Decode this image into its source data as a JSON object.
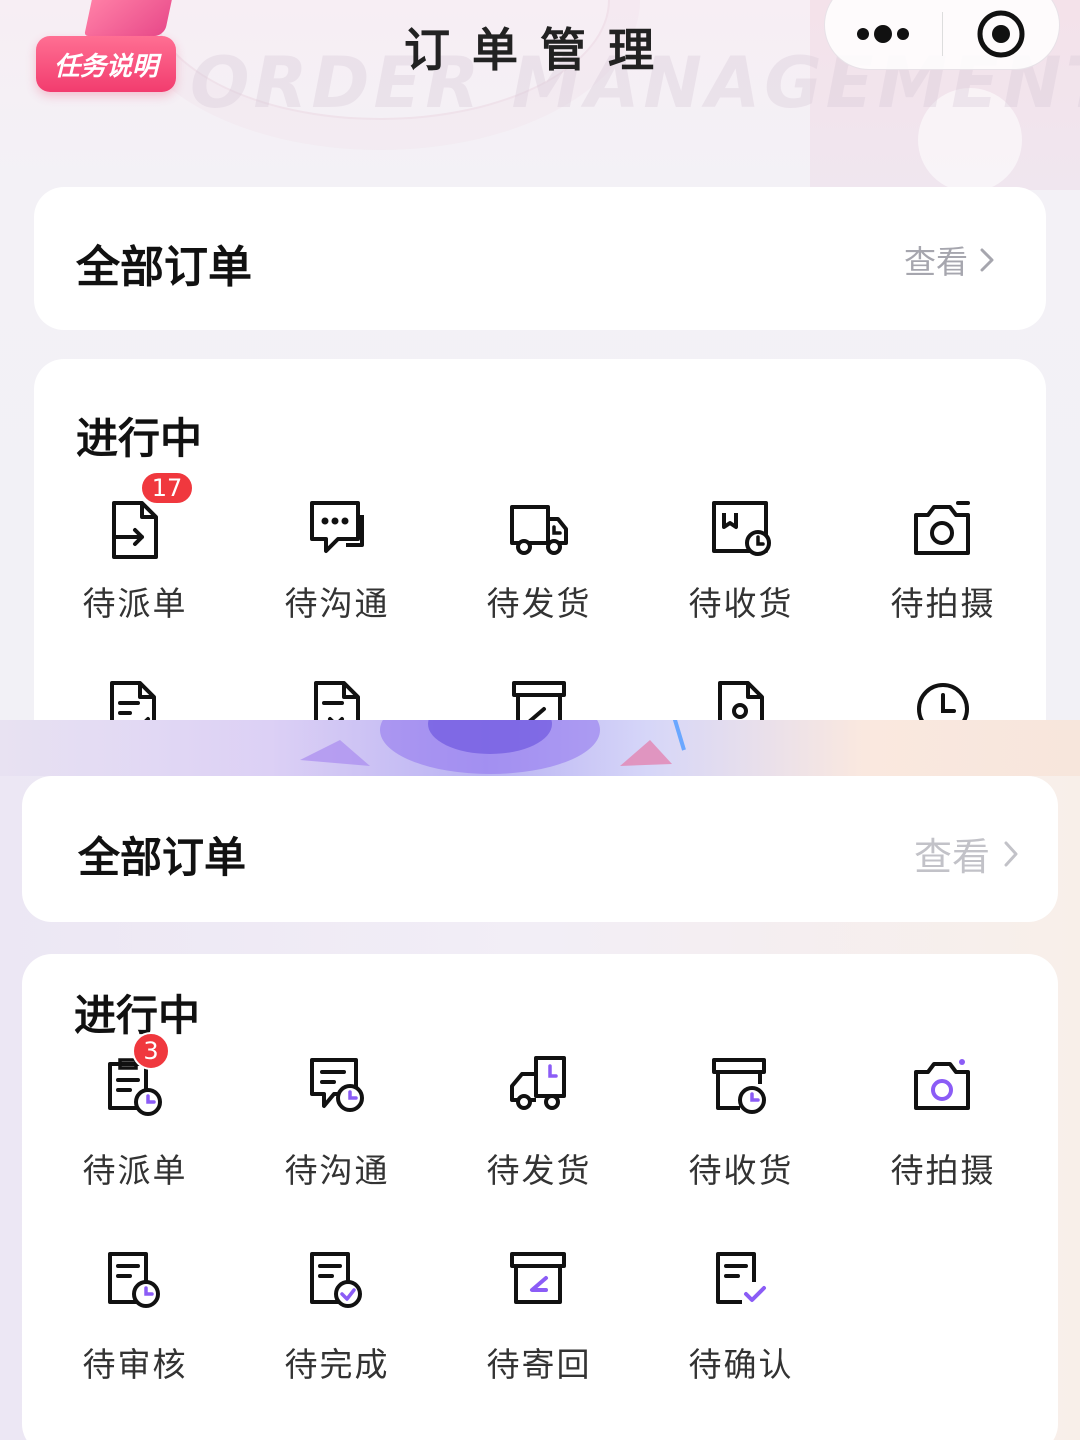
{
  "header": {
    "task_button_label": "任务说明",
    "title": "订单管理",
    "watermark": "ORDER MANAGEMENT"
  },
  "top_panel": {
    "all_orders": {
      "title": "全部订单",
      "view_label": "查看"
    },
    "in_progress": {
      "title": "进行中",
      "items": [
        {
          "label": "待派单",
          "icon": "document-arrow-icon",
          "badge": "17"
        },
        {
          "label": "待沟通",
          "icon": "chat-bubble-icon"
        },
        {
          "label": "待发货",
          "icon": "delivery-truck-icon"
        },
        {
          "label": "待收货",
          "icon": "receive-box-icon"
        },
        {
          "label": "待拍摄",
          "icon": "camera-icon"
        }
      ]
    }
  },
  "bottom_panel": {
    "all_orders": {
      "title": "全部订单",
      "view_label": "查看"
    },
    "in_progress": {
      "title": "进行中",
      "items": [
        {
          "label": "待派单",
          "icon": "clipboard-clock-icon",
          "badge": "3"
        },
        {
          "label": "待沟通",
          "icon": "chat-clock-icon"
        },
        {
          "label": "待发货",
          "icon": "truck-clock-icon"
        },
        {
          "label": "待收货",
          "icon": "box-clock-icon"
        },
        {
          "label": "待拍摄",
          "icon": "camera-icon"
        },
        {
          "label": "待审核",
          "icon": "doc-clock-icon"
        },
        {
          "label": "待完成",
          "icon": "doc-check-icon"
        },
        {
          "label": "待寄回",
          "icon": "return-box-icon"
        },
        {
          "label": "待确认",
          "icon": "doc-confirm-icon"
        }
      ]
    }
  },
  "colors": {
    "accent_purple": "#8b5cf6",
    "badge_red": "#f0383e",
    "task_button_pink": "#f23c6e"
  }
}
